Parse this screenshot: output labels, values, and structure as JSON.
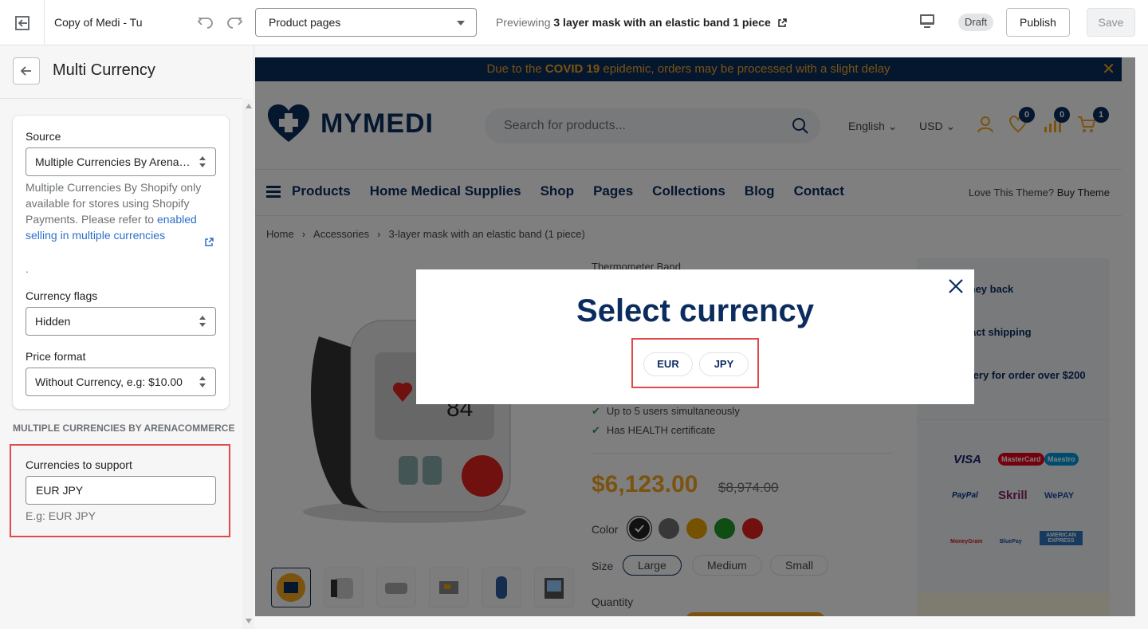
{
  "topbar": {
    "theme_name": "Copy of Medi - Tu",
    "page_select": "Product pages",
    "preview_prefix": "Previewing",
    "preview_product": "3 layer mask with an elastic band 1 piece",
    "draft": "Draft",
    "publish": "Publish",
    "save": "Save"
  },
  "sidebar": {
    "title": "Multi Currency",
    "source_label": "Source",
    "source_value": "Multiple Currencies By Arenac...",
    "help_text": "Multiple Currencies By Shopify only available for stores using Shopify Payments. Please refer to",
    "help_link": "enabled selling in multiple currencies",
    "help_dot": ".",
    "flags_label": "Currency flags",
    "flags_value": "Hidden",
    "price_format_label": "Price format",
    "price_format_value": "Without Currency, e.g: $10.00",
    "section_heading": "MULTIPLE CURRENCIES BY ARENACOMMERCE",
    "currencies_label": "Currencies to support",
    "currencies_value": "EUR JPY",
    "currencies_hint": "E.g: EUR JPY"
  },
  "store": {
    "banner_pre": "Due to the ",
    "banner_bold": "COVID 19",
    "banner_post": " epidemic, orders may be processed with a slight delay",
    "banner_close": "✕",
    "logo": "MYMEDI",
    "search_placeholder": "Search for products...",
    "language": "English",
    "currency": "USD",
    "wishlist_count": "0",
    "compare_count": "0",
    "cart_count": "1",
    "nav": [
      "Products",
      "Home Medical Supplies",
      "Shop",
      "Pages",
      "Collections",
      "Blog",
      "Contact"
    ],
    "love_text": "Love This Theme?",
    "buy_theme": "Buy Theme",
    "breadcrumb": [
      "Home",
      "Accessories",
      "3-layer mask with an elastic band (1 piece)"
    ],
    "breadcrumb_sep": "›",
    "product_type": "Thermometer Band",
    "features": [
      "Up to 5 users simultaneously",
      "Has HEALTH certificate"
    ],
    "price": "$6,123.00",
    "old_price": "$8,974.00",
    "color_label": "Color",
    "size_label": "Size",
    "sizes": [
      "Large",
      "Medium",
      "Small"
    ],
    "quantity_label": "Quantity",
    "perks": [
      "100% Money back",
      "Non-contact shipping",
      "Free delivery for order over $200"
    ],
    "payments": [
      "VISA",
      "MasterCard",
      "Maestro",
      "PayPal",
      "Skrill",
      "WePAY",
      "MoneyGram",
      "BluePay",
      "AMERICAN EXPRESS"
    ],
    "swatch_colors": [
      "#222222",
      "#707070",
      "#e8a400",
      "#1e9a2b",
      "#e0201e"
    ]
  },
  "modal": {
    "title": "Select currency",
    "options": [
      "EUR",
      "JPY"
    ]
  },
  "colors": {
    "navy": "#0b2c5f",
    "accent": "#f5a623",
    "highlight": "#e04a4a"
  }
}
